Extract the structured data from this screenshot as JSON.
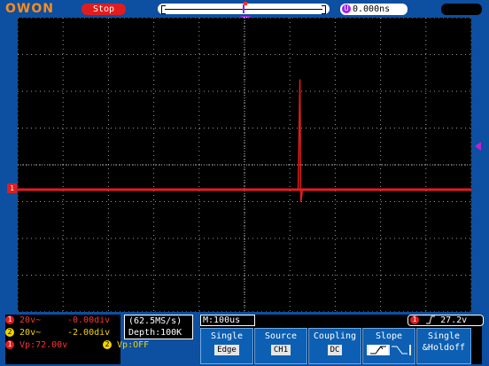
{
  "brand": "OWON",
  "run_status": "Stop",
  "offset_label": "U",
  "horizontal_offset": "0.000ns",
  "trigger_pos_label": "U",
  "ch1_marker": "1",
  "colors": {
    "ch1": "#e01d1d",
    "ch2": "#f2d400",
    "panel_blue": "#0d4fa0",
    "softkey_blue": "#0d5fb3"
  },
  "channels": [
    {
      "num": "1",
      "coupling": "20v~",
      "offset": "-0.00div"
    },
    {
      "num": "2",
      "coupling": "20v~",
      "offset": "-2.00div"
    }
  ],
  "measurements": [
    {
      "num": "1",
      "text": "Vp:72.00v"
    },
    {
      "num": "2",
      "text": "Vp:OFF"
    }
  ],
  "sample_rate": "(62.5MS/s)",
  "depth": "Depth:100K",
  "timebase": "M:100us",
  "trigger_status": {
    "num": "1",
    "slope_icon": "rising-edge-icon",
    "level": "27.2v"
  },
  "softkeys": [
    {
      "title": "Single",
      "value": "Edge"
    },
    {
      "title": "Source",
      "value": "CH1"
    },
    {
      "title": "Coupling",
      "value": "DC"
    },
    {
      "title": "Slope",
      "value": ""
    },
    {
      "title": "Single",
      "value": "&Holdoff"
    }
  ],
  "waveform": {
    "baseline_div": -0.0,
    "spike_peak_div": 3.0,
    "spike_time_div": 6.3
  }
}
